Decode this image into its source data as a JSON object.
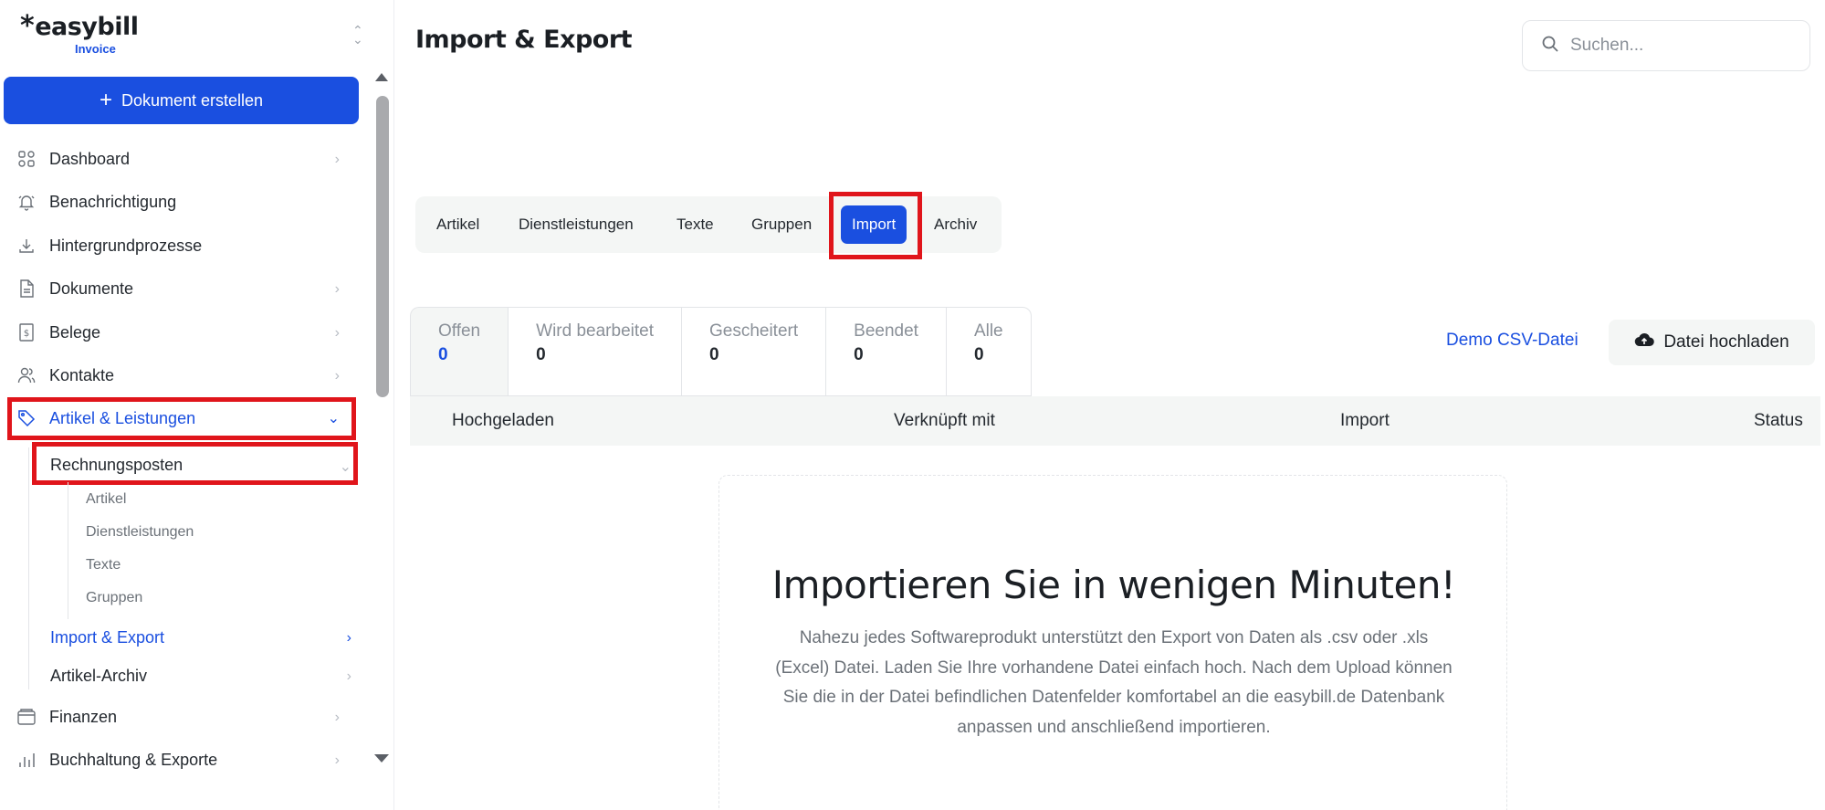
{
  "brand": {
    "name": "easybill",
    "sub": "Invoice"
  },
  "sidebar": {
    "create_button": "Dokument erstellen",
    "items": [
      {
        "label": "Dashboard",
        "icon": "dashboard-icon"
      },
      {
        "label": "Benachrichtigung",
        "icon": "bell-icon"
      },
      {
        "label": "Hintergrundprozesse",
        "icon": "download-icon"
      },
      {
        "label": "Dokumente",
        "icon": "document-icon"
      },
      {
        "label": "Belege",
        "icon": "receipt-icon"
      },
      {
        "label": "Kontakte",
        "icon": "contacts-icon"
      },
      {
        "label": "Artikel & Leistungen",
        "icon": "tag-icon"
      },
      {
        "label": "Finanzen",
        "icon": "wallet-icon"
      },
      {
        "label": "Buchhaltung & Exporte",
        "icon": "chart-icon"
      }
    ],
    "sub_items": {
      "rechnungsposten": "Rechnungsposten",
      "artikel": "Artikel",
      "dienstleistungen": "Dienstleistungen",
      "texte": "Texte",
      "gruppen": "Gruppen",
      "import_export": "Import & Export",
      "artikel_archiv": "Artikel-Archiv"
    }
  },
  "header": {
    "title": "Import & Export",
    "search_placeholder": "Suchen..."
  },
  "tabs": [
    "Artikel",
    "Dienstleistungen",
    "Texte",
    "Gruppen",
    "Import",
    "Archiv"
  ],
  "status_tabs": [
    {
      "label": "Offen",
      "count": "0"
    },
    {
      "label": "Wird bearbeitet",
      "count": "0"
    },
    {
      "label": "Gescheitert",
      "count": "0"
    },
    {
      "label": "Beendet",
      "count": "0"
    },
    {
      "label": "Alle",
      "count": "0"
    }
  ],
  "actions": {
    "demo": "Demo CSV-Datei",
    "upload": "Datei hochladen"
  },
  "table": {
    "columns": [
      "Hochgeladen",
      "Verknüpft mit",
      "Import",
      "Status"
    ]
  },
  "empty": {
    "title": "Importieren Sie in wenigen Minuten!",
    "text": "Nahezu jedes Softwareprodukt unterstützt den Export von Daten als .csv oder .xls (Excel) Datei. Laden Sie Ihre vorhandene Datei einfach hoch. Nach dem Upload können Sie die in der Datei befindlichen Datenfelder komfortabel an die easybill.de Datenbank anpassen und anschließend importieren."
  },
  "colors": {
    "accent": "#1a4fe0",
    "highlight": "#e0151b",
    "surface": "#f4f6f5"
  }
}
